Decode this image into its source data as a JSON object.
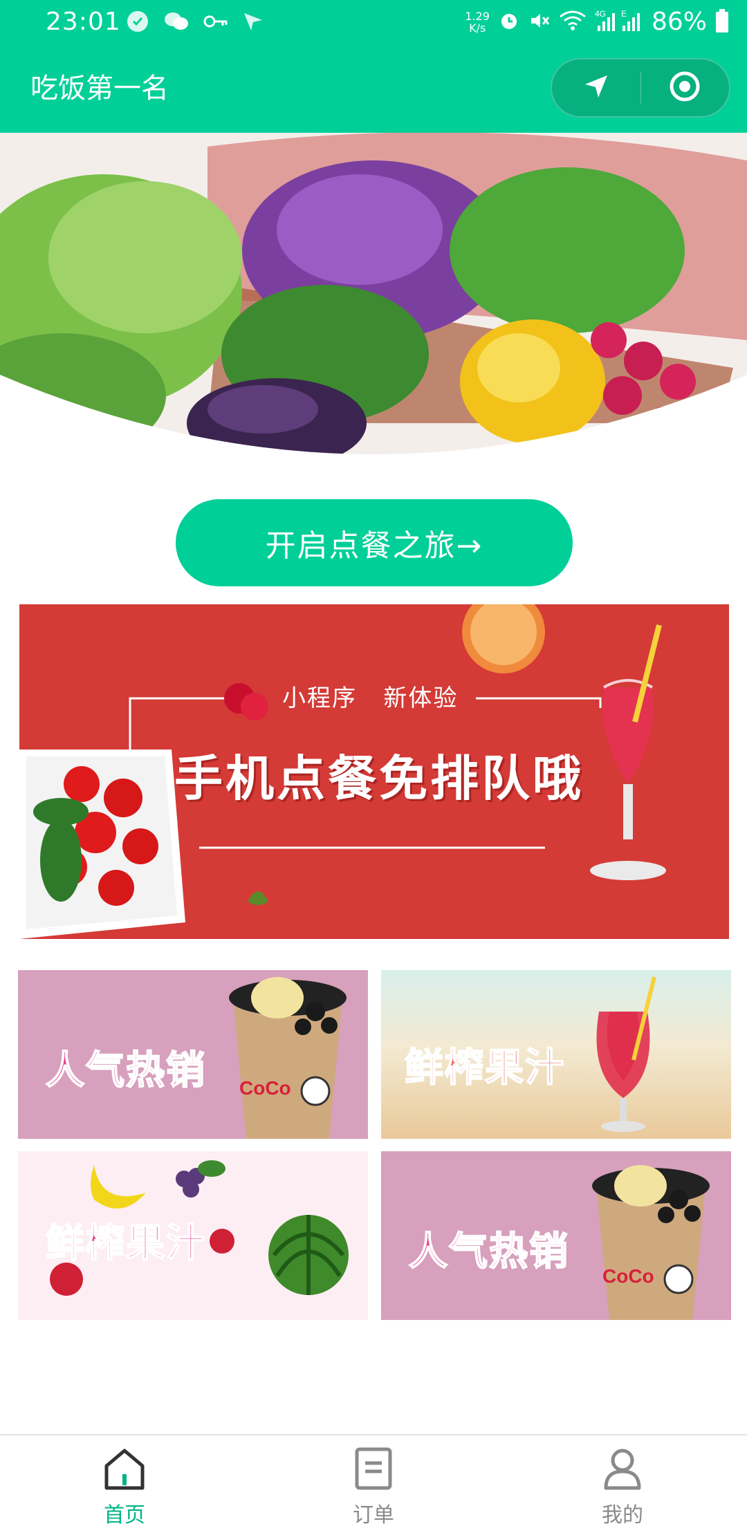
{
  "status_bar": {
    "time": "23:01",
    "net_speed_value": "1.29",
    "net_speed_unit": "K/s",
    "network_label": "4G",
    "network_label_2": "E",
    "battery": "86%",
    "icons": [
      "whatsapp-icon",
      "wechat-icon",
      "key-icon",
      "send-icon",
      "alarm-icon",
      "mute-icon",
      "wifi-icon",
      "signal-icon",
      "battery-icon"
    ]
  },
  "header": {
    "title": "吃饭第一名",
    "capsule": [
      "location-arrow-icon",
      "target-icon"
    ]
  },
  "start_button": {
    "label": "开启点餐之旅→"
  },
  "banner": {
    "subtitle": "小程序   新体验",
    "headline": "手机点餐免排队哦"
  },
  "tiles": [
    {
      "label": "人气热销",
      "color": "#e8418f"
    },
    {
      "label": "鲜榨果汁",
      "color": "#ef6a6a"
    },
    {
      "label": "鲜榨果汁",
      "color": "#e8418f"
    },
    {
      "label": "人气热销",
      "color": "#e8418f"
    }
  ],
  "tabbar": {
    "items": [
      {
        "label": "首页",
        "icon": "home-icon",
        "active": true
      },
      {
        "label": "订单",
        "icon": "order-icon",
        "active": false
      },
      {
        "label": "我的",
        "icon": "profile-icon",
        "active": false
      }
    ]
  },
  "colors": {
    "brand": "#00cf98",
    "active_tab": "#00b585",
    "banner_red": "#d43a36"
  }
}
